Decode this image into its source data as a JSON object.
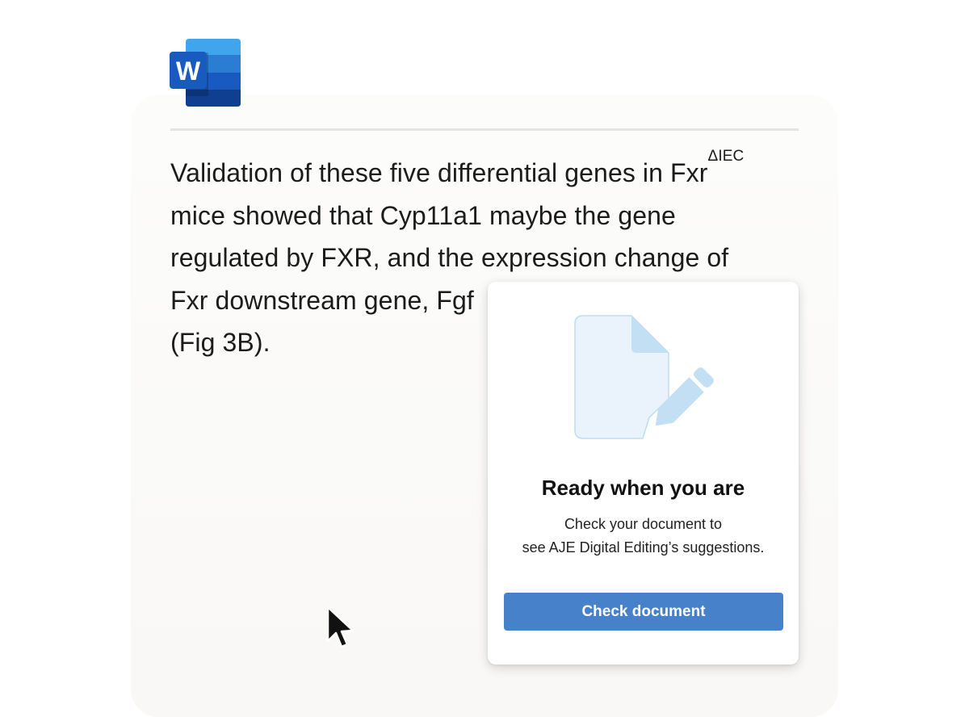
{
  "app": {
    "logo_letter": "W",
    "logo_icon": "microsoft-word-icon"
  },
  "document": {
    "lines": [
      {
        "text": "Validation of these five differential genes in Fxr",
        "sup": "ΔIEC"
      },
      {
        "text": "mice showed that Cyp11a1 maybe the gene"
      },
      {
        "text": "regulated by FXR, and the expression change of"
      },
      {
        "text": "Fxr downstream gene, Fgf"
      },
      {
        "text": "(Fig 3B)."
      }
    ]
  },
  "panel": {
    "illustration_icon": "document-edit-icon",
    "title": "Ready when you are",
    "description_line1": "Check your document to",
    "description_line2": "see AJE Digital Editing’s suggestions.",
    "button_label": "Check document"
  },
  "colors": {
    "accent": "#4681c9",
    "word_blue_light": "#41a5ee",
    "word_blue_dark": "#185abd",
    "illustration_fill": "#eaf3fb",
    "illustration_stroke": "#bedcf2"
  },
  "pointer": {
    "icon": "mouse-pointer-icon"
  }
}
